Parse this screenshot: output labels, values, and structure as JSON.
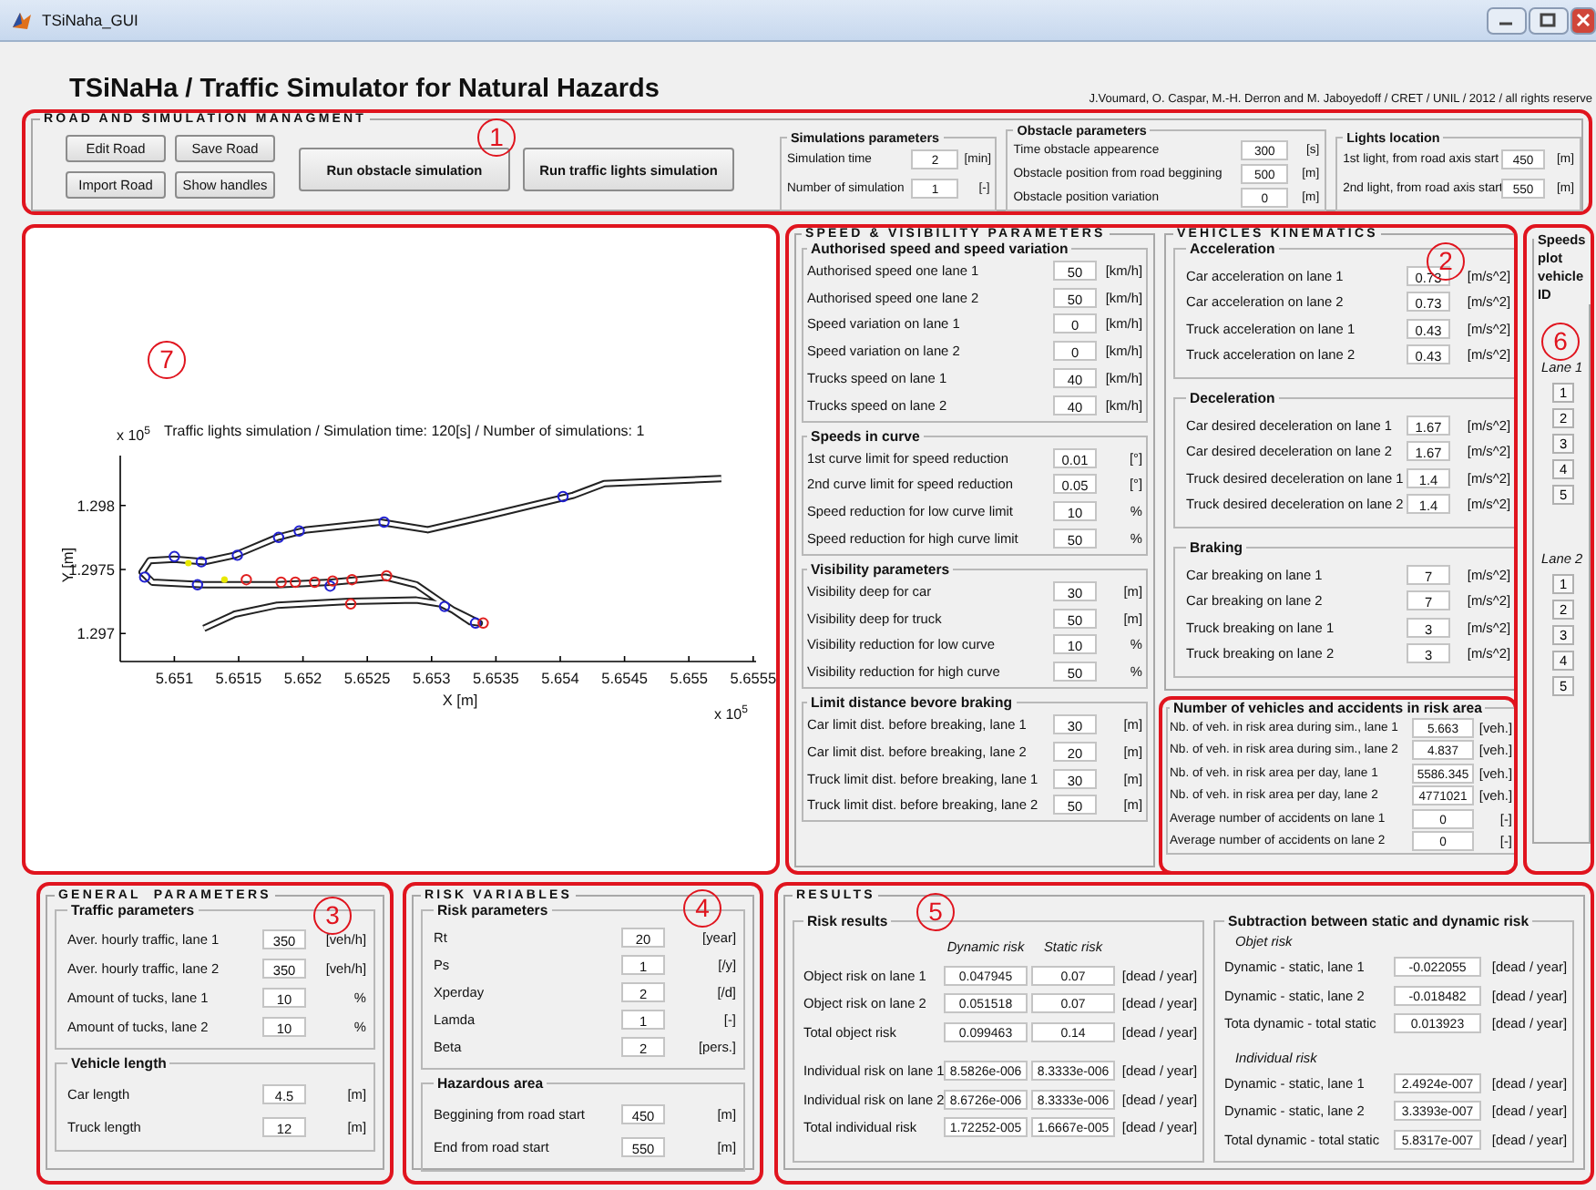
{
  "window": {
    "title": "TSiNaha_GUI"
  },
  "header": {
    "title": "TSiNaHa / Traffic Simulator for Natural Hazards",
    "credits": "J.Voumard, O. Caspar, M.-H. Derron and M. Jaboyedoff / CRET / UNIL / 2012 / all rights reserve"
  },
  "road_panel": {
    "callout": "1",
    "title": "ROAD AND SIMULATION MANAGMENT",
    "buttons": [
      {
        "label": "Edit Road",
        "kind": "small"
      },
      {
        "label": "Save Road",
        "kind": "small"
      },
      {
        "label": "Import Road",
        "kind": "small"
      },
      {
        "label": "Show handles",
        "kind": "small"
      },
      {
        "label": "Run obstacle simulation",
        "kind": "large"
      },
      {
        "label": "Run traffic lights simulation",
        "kind": "large"
      }
    ],
    "groups": [
      {
        "title": "Simulations parameters",
        "rows": [
          {
            "label": "Simulation time",
            "value": "2",
            "unit": "[min]"
          },
          {
            "label": "Number of simulation",
            "value": "1",
            "unit": "[-]"
          }
        ]
      },
      {
        "title": "Obstacle parameters",
        "rows": [
          {
            "label": "Time obstacle appearence",
            "value": "300",
            "unit": "[s]"
          },
          {
            "label": "Obstacle position from road beggining",
            "value": "500",
            "unit": "[m]"
          },
          {
            "label": "Obstacle position variation",
            "value": "0",
            "unit": "[m]"
          }
        ]
      },
      {
        "title": "Lights location",
        "rows": [
          {
            "label": "1st light, from road axis start",
            "value": "450",
            "unit": "[m]"
          },
          {
            "label": "2nd light, from road axis start",
            "value": "550",
            "unit": "[m]"
          }
        ]
      }
    ]
  },
  "plot_panel": {
    "callout": "7",
    "title": "Traffic lights simulation / Simulation time: 120[s] / Number of simulations: 1",
    "x_label": "X [m]",
    "y_label": "Y [m]",
    "x_multiplier": "x 10$^{5}$",
    "y_multiplier": "x 10$^{5}$",
    "x_ticks": [
      "5.651",
      "5.6515",
      "5.652",
      "5.6525",
      "5.653",
      "5.6535",
      "5.654",
      "5.6545",
      "5.655",
      "5.6555"
    ],
    "y_ticks": [
      "1.298",
      "1.2975",
      "1.297"
    ]
  },
  "parameters_frame": {
    "callout": "2",
    "panels": [
      {
        "title": "SPEED & VISIBILITY PARAMETERS",
        "groups": [
          {
            "title": "Authorised speed and speed variation",
            "rows": [
              {
                "label": "Authorised speed one lane 1",
                "value": "50",
                "unit": "[km/h]"
              },
              {
                "label": "Authorised speed one lane 2",
                "value": "50",
                "unit": "[km/h]"
              },
              {
                "label": "Speed variation on lane 1",
                "value": "0",
                "unit": "[km/h]"
              },
              {
                "label": "Speed variation on lane 2",
                "value": "0",
                "unit": "[km/h]"
              },
              {
                "label": "Trucks speed on lane 1",
                "value": "40",
                "unit": "[km/h]"
              },
              {
                "label": "Trucks speed on lane 2",
                "value": "40",
                "unit": "[km/h]"
              }
            ]
          },
          {
            "title": "Speeds in curve",
            "rows": [
              {
                "label": "1st curve limit for speed reduction",
                "value": "0.01",
                "unit": "[°]"
              },
              {
                "label": "2nd curve limit for speed reduction",
                "value": "0.05",
                "unit": "[°]"
              },
              {
                "label": "Speed reduction for low curve limit",
                "value": "10",
                "unit": "%"
              },
              {
                "label": "Speed reduction for high curve limit",
                "value": "50",
                "unit": "%"
              }
            ]
          },
          {
            "title": "Visibility parameters",
            "rows": [
              {
                "label": "Visibility deep for car",
                "value": "30",
                "unit": "[m]"
              },
              {
                "label": "Visibility deep for truck",
                "value": "50",
                "unit": "[m]"
              },
              {
                "label": "Visibility reduction for low curve",
                "value": "10",
                "unit": "%"
              },
              {
                "label": "Visibility reduction for high curve",
                "value": "50",
                "unit": "%"
              }
            ]
          },
          {
            "title": "Limit distance bevore braking",
            "rows": [
              {
                "label": "Car limit dist. before breaking, lane 1",
                "value": "30",
                "unit": "[m]"
              },
              {
                "label": "Car limit dist. before breaking, lane 2",
                "value": "20",
                "unit": "[m]"
              },
              {
                "label": "Truck limit dist. before breaking, lane 1",
                "value": "30",
                "unit": "[m]"
              },
              {
                "label": "Truck limit dist. before breaking, lane 2",
                "value": "50",
                "unit": "[m]"
              }
            ]
          }
        ]
      },
      {
        "title": "VEHICLES KINEMATICS",
        "groups": [
          {
            "title": "Acceleration",
            "rows": [
              {
                "label": "Car acceleration on lane 1",
                "value": "0.73",
                "unit": "[m/s^2]"
              },
              {
                "label": "Car acceleration on lane 2",
                "value": "0.73",
                "unit": "[m/s^2]"
              },
              {
                "label": "Truck acceleration on lane 1",
                "value": "0.43",
                "unit": "[m/s^2]"
              },
              {
                "label": "Truck acceleration on lane 2",
                "value": "0.43",
                "unit": "[m/s^2]"
              }
            ]
          },
          {
            "title": "Deceleration",
            "rows": [
              {
                "label": "Car desired deceleration on lane 1",
                "value": "1.67",
                "unit": "[m/s^2]"
              },
              {
                "label": "Car desired deceleration on lane 2",
                "value": "1.67",
                "unit": "[m/s^2]"
              },
              {
                "label": "Truck desired deceleration on lane 1",
                "value": "1.4",
                "unit": "[m/s^2]"
              },
              {
                "label": "Truck desired deceleration on lane 2",
                "value": "1.4",
                "unit": "[m/s^2]"
              }
            ]
          },
          {
            "title": "Braking",
            "rows": [
              {
                "label": "Car breaking on lane 1",
                "value": "7",
                "unit": "[m/s^2]"
              },
              {
                "label": "Car breaking on lane 2",
                "value": "7",
                "unit": "[m/s^2]"
              },
              {
                "label": "Truck breaking on lane 1",
                "value": "3",
                "unit": "[m/s^2]"
              },
              {
                "label": "Truck breaking on lane 2",
                "value": "3",
                "unit": "[m/s^2]"
              }
            ]
          }
        ]
      }
    ],
    "risk_area": {
      "title": "Number of vehicles and accidents in risk area",
      "rows": [
        {
          "label": "Nb. of veh. in risk area during sim., lane 1",
          "value": "5.663",
          "unit": "[veh.]"
        },
        {
          "label": "Nb. of veh. in risk area during sim., lane 2",
          "value": "4.837",
          "unit": "[veh.]"
        },
        {
          "label": "Nb. of veh. in risk area per day, lane 1",
          "value": "5586.345",
          "unit": "[veh.]"
        },
        {
          "label": "Nb. of veh. in risk area per day, lane 2",
          "value": "4771021",
          "unit": "[veh.]"
        },
        {
          "label": "Average number of accidents on lane 1",
          "value": "0",
          "unit": "[-]"
        },
        {
          "label": "Average number of accidents on lane 2",
          "value": "0",
          "unit": "[-]"
        }
      ]
    }
  },
  "speeds_plot": {
    "callout": "6",
    "title": "Speeds plot vehicle ID",
    "lanes": [
      {
        "label": "Lane 1",
        "ids": [
          "1",
          "2",
          "3",
          "4",
          "5"
        ]
      },
      {
        "label": "Lane 2",
        "ids": [
          "1",
          "2",
          "3",
          "4",
          "5"
        ]
      }
    ]
  },
  "general_parameters": {
    "callout": "3",
    "title": "GENERAL  PARAMETERS",
    "groups": [
      {
        "title": "Traffic parameters",
        "rows": [
          {
            "label": "Aver. hourly traffic, lane 1",
            "value": "350",
            "unit": "[veh/h]"
          },
          {
            "label": "Aver. hourly traffic, lane 2",
            "value": "350",
            "unit": "[veh/h]"
          },
          {
            "label": "Amount of tucks, lane 1",
            "value": "10",
            "unit": "%"
          },
          {
            "label": "Amount of tucks, lane 2",
            "value": "10",
            "unit": "%"
          }
        ]
      },
      {
        "title": "Vehicle length",
        "rows": [
          {
            "label": "Car length",
            "value": "4.5",
            "unit": "[m]"
          },
          {
            "label": "Truck length",
            "value": "12",
            "unit": "[m]"
          }
        ]
      }
    ]
  },
  "risk_variables": {
    "callout": "4",
    "title": "RISK VARIABLES",
    "groups": [
      {
        "title": "Risk parameters",
        "rows": [
          {
            "label": "Rt",
            "value": "20",
            "unit": "[year]"
          },
          {
            "label": "Ps",
            "value": "1",
            "unit": "[/y]"
          },
          {
            "label": "Xperday",
            "value": "2",
            "unit": "[/d]"
          },
          {
            "label": "Lamda",
            "value": "1",
            "unit": "[-]"
          },
          {
            "label": "Beta",
            "value": "2",
            "unit": "[pers.]"
          }
        ]
      },
      {
        "title": "Hazardous area",
        "rows": [
          {
            "label": "Beggining from road start",
            "value": "450",
            "unit": "[m]"
          },
          {
            "label": "End from road start",
            "value": "550",
            "unit": "[m]"
          }
        ]
      }
    ]
  },
  "results": {
    "callout": "5",
    "title": "RESULTS",
    "groups": [
      {
        "title": "Risk results",
        "sections": [
          {
            "columns": [
              "Dynamic risk",
              "Static risk"
            ],
            "rows": [
              {
                "label": "Object risk on lane 1",
                "values": [
                  "0.047945",
                  "0.07"
                ],
                "unit": "[dead / year]"
              },
              {
                "label": "Object risk on lane 2",
                "values": [
                  "0.051518",
                  "0.07"
                ],
                "unit": "[dead / year]"
              },
              {
                "label": "Total object risk",
                "values": [
                  "0.099463",
                  "0.14"
                ],
                "unit": "[dead / year]"
              }
            ]
          },
          {
            "rows": [
              {
                "label": "Individual risk on lane 1",
                "values": [
                  "8.5826e-006",
                  "8.3333e-006"
                ],
                "unit": "[dead / year]"
              },
              {
                "label": "Individual risk on lane 2",
                "values": [
                  "8.6726e-006",
                  "8.3333e-006"
                ],
                "unit": "[dead / year]"
              },
              {
                "label": "Total individual risk",
                "values": [
                  "1.72252-005",
                  "1.6667e-005"
                ],
                "unit": "[dead / year]"
              }
            ]
          }
        ]
      },
      {
        "title": "Subtraction between static and dynamic risk",
        "sections": [
          {
            "heading": "Objet risk",
            "rows": [
              {
                "label": "Dynamic - static, lane 1",
                "value": "-0.022055",
                "unit": "[dead / year]"
              },
              {
                "label": "Dynamic - static, lane 2",
                "value": "-0.018482",
                "unit": "[dead / year]"
              },
              {
                "label": "Tota dynamic - total static",
                "value": "0.013923",
                "unit": "[dead / year]"
              }
            ]
          },
          {
            "heading": "Individual risk",
            "rows": [
              {
                "label": "Dynamic - static, lane 1",
                "value": "2.4924e-007",
                "unit": "[dead / year]"
              },
              {
                "label": "Dynamic - static, lane 2",
                "value": "3.3393e-007",
                "unit": "[dead / year]"
              },
              {
                "label": "Total dynamic - total static",
                "value": "5.8317e-007",
                "unit": "[dead / year]"
              }
            ]
          }
        ]
      }
    ]
  }
}
